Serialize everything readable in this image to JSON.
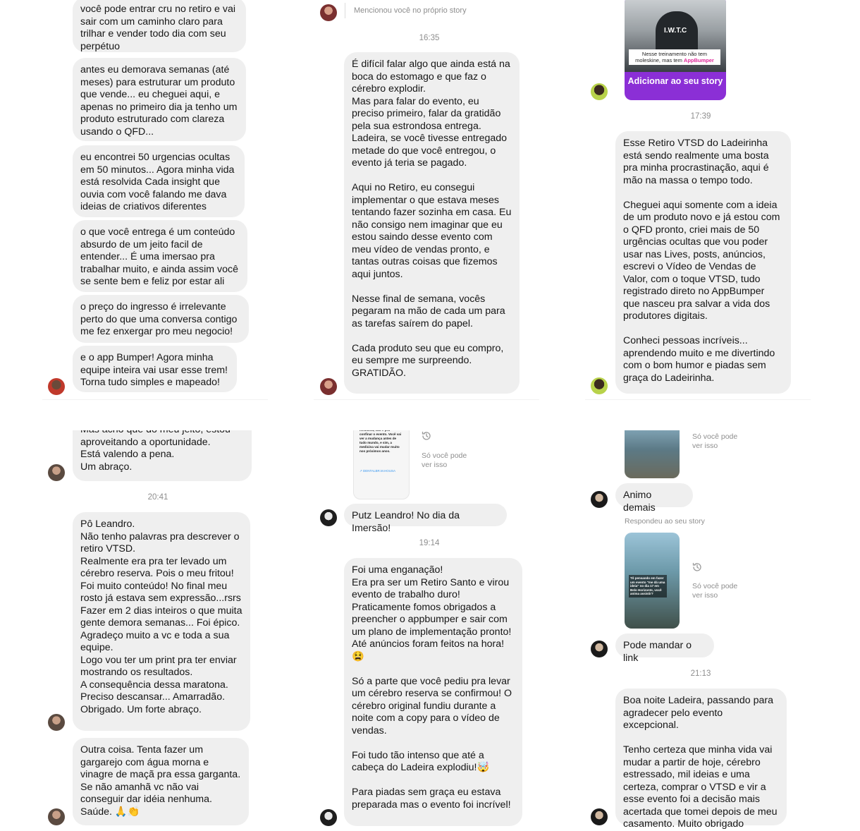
{
  "panel1": {
    "messages": [
      "você pode entrar cru no retiro e vai sair com um caminho claro para trilhar e vender todo dia com seu perpétuo",
      "antes eu demorava semanas (até meses) para estruturar um produto que vende... eu cheguei aqui, e apenas no primeiro dia ja tenho um produto estruturado com clareza usando o QFD...",
      "eu encontrei 50 urgencias ocultas em 50 minutos... Agora minha vida está resolvida Cada insight que ouvia com você falando me dava ideias de criativos diferentes",
      "o que você entrega é um conteúdo absurdo de um jeito facil de entender... É uma imersao pra trabalhar muito, e ainda assim você se sente bem e feliz por estar ali",
      "o preço do ingresso é irrelevante perto do que uma conversa contigo me fez enxergar pro meu negocio!",
      "e o app Bumper! Agora minha equipe inteira vai usar esse trem! Torna tudo simples e mapeado!"
    ]
  },
  "panel2": {
    "mention": "Mencionou você no próprio story",
    "time": "16:35",
    "message": "É difícil falar algo que ainda está na boca do estomago e que faz o cérebro explodir.\nMas para falar do evento, eu preciso primeiro, falar da gratidão pela sua estrondosa entrega.\nLadeira, se você tivesse entregado metade do que você entregou, o evento já teria se pagado.\n\nAqui no Retiro, eu consegui implementar o que estava meses tentando fazer sozinha em casa. Eu não consigo nem imaginar que eu estou saindo desse evento com meu vídeo de vendas pronto, e tantas outras coisas que fizemos aqui juntos.\n\nNesse final de semana, vocês pegaram na mão de cada um para as tarefas saírem do papel.\n\nCada produto seu que eu compro, eu sempre me surpreendo. GRATIDÃO."
  },
  "panel3": {
    "story_caption_1": "Nesse treinamento não tem moleskine, mas tem",
    "story_caption_brand": "AppBumper",
    "story_shirt_text": "I.W.T.C",
    "add_story_button": "Adicionar ao seu story",
    "time": "17:39",
    "message": "Esse Retiro VTSD do Ladeirinha está sendo realmente uma bosta pra minha procrastinação, aqui é mão na massa o tempo todo.\n\nCheguei aqui somente com a ideia de um produto novo e já estou com o QFD pronto, criei mais de 50 urgências ocultas que vou poder usar nas Lives, posts, anúncios, escrevi o Vídeo de Vendas de Valor, com o toque VTSD, tudo registrado direto no AppBumper que nasceu pra salvar a vida dos produtores digitais.\n\nConheci pessoas incríveis... aprendendo muito e me divertindo com o bom humor e piadas sem graça do Ladeirinha."
  },
  "panel4": {
    "msg_top": "Mas acho que do meu jeito, estou aproveitando a oportunidade.\nEstá valendo a pena.\nUm abraço.",
    "time": "20:41",
    "msg_main": "Pô Leandro.\nNão tenho palavras pra descrever o retiro VTSD.\nRealmente era pra ter levado um cérebro reserva. Pois o meu fritou!\nFoi muito conteúdo! No final meu rosto já estava sem expressão...rsrs\nFazer em 2 dias inteiros o que muita gente demora semanas... Foi épico.\nAgradeço muito a vc e toda a sua equipe.\nLogo vou ter um print pra ter enviar mostrando os resultados.\nA consequência dessa maratona.\nPreciso descansar... Amarradão.\nObrigado. Um forte abraço.",
    "msg_last": "Outra coisa. Tenta fazer um gargarejo com água morna e vinagre de maçã pra essa garganta.\nSe não amanhã vc não vai conseguir dar idéia nenhuma.\nSaúde. 🙏👏"
  },
  "panel5": {
    "only_you": "Só você pode ver isso",
    "story_text": "medicina, não é pra confinar o evento. Você vai ver a mudança antes de tudo mundo, e sim, a medicina vai mudar muito nos próximos anos.",
    "story_link": "↗ DENTALBR.M.HOUSA",
    "msg_short": "Putz Leandro! No dia da Imersão!",
    "time": "19:14",
    "message": "Foi uma enganação!\nEra pra ser um Retiro Santo e virou evento de trabalho duro!\nPraticamente fomos obrigados a preencher o appbumper e sair com um plano de implementação pronto! Até anúncios foram feitos na hora! 😫\n\nSó a parte que você pediu pra levar um cérebro reserva se confirmou! O cérebro original fundiu durante a noite com a copy para o vídeo de vendas.\n\nFoi tudo tão intenso que até a cabeça do Ladeira explodiu!🤯\n\nPara piadas sem graça eu estava preparada mas o evento foi incrível!"
  },
  "panel6": {
    "only_you_1": "Só você pode ver isso",
    "msg1": "Animo demais",
    "replied": "Respondeu ao seu story",
    "only_you_2": "Só você pode ver isso",
    "msg2": "Pode mandar o link",
    "time": "21:13",
    "message": "Boa noite Ladeira, passando para agradecer pelo evento excepcional.\n\nTenho certeza que minha vida vai mudar a partir de hoje, cérebro estressado, mil ideias e uma certeza, comprar o VTSD e vir a esse evento foi a decisão mais acertada que tomei depois de meu casamento. Muito obrigado",
    "story_text": "Tô pensando em fazer um evento \"me dá uma ideia\" no dia 17 em Belo Horizonte, você anima assistir?"
  },
  "colors": {
    "bubble": "#efefef",
    "meta": "#8e8e8e",
    "brand_purple": "#8b2fd6"
  }
}
